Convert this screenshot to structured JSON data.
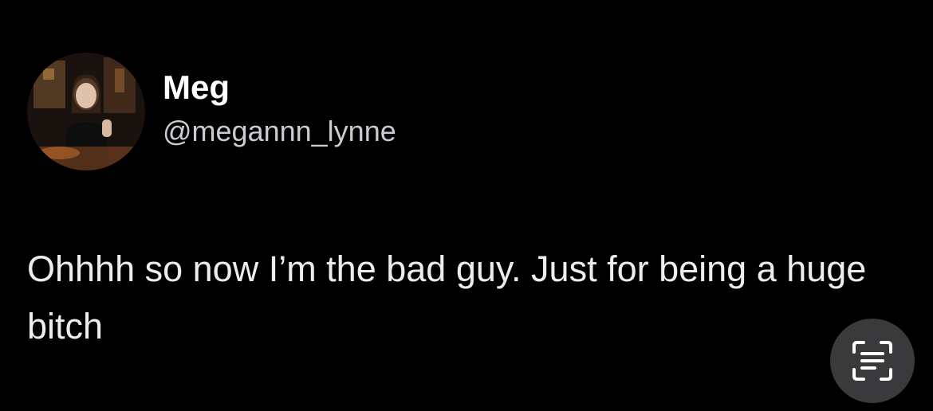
{
  "author": {
    "display_name": "Meg",
    "handle": "@megannn_lynne",
    "avatar_icon": "profile-photo"
  },
  "tweet": {
    "text": "Ohhhh so now I’m the bad guy. Just for being a huge bitch"
  },
  "overlay": {
    "scan_icon": "text-scan-icon"
  },
  "colors": {
    "background": "#000000",
    "text_primary": "#ffffff",
    "text_secondary": "#c9cdd1",
    "button_bg": "#3a3a3c"
  }
}
